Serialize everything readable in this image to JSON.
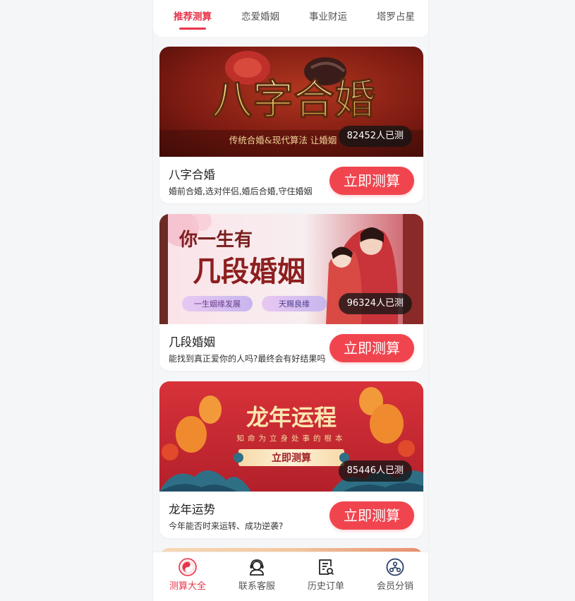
{
  "tabs": [
    {
      "label": "推荐测算",
      "active": true
    },
    {
      "label": "恋爱婚姻",
      "active": false
    },
    {
      "label": "事业财运",
      "active": false
    },
    {
      "label": "塔罗占星",
      "active": false
    }
  ],
  "cards": [
    {
      "banner_title": "八字合婚",
      "banner_subtitle": "传统合婚&现代算法  让婚姻",
      "count": "82452人已测",
      "title": "八字合婚",
      "desc": "婚前合婚,选对伴侣,婚后合婚,守住婚姻",
      "cta": "立即测算"
    },
    {
      "banner_title_top": "你一生有",
      "banner_title": "几段婚姻",
      "banner_tag1": "一生姻缘发展",
      "banner_tag2": "天赐良缘",
      "count": "96324人已测",
      "title": "几段婚姻",
      "desc": "能找到真正爱你的人吗?最终会有好结果吗",
      "cta": "立即测算"
    },
    {
      "banner_title": "龙年运程",
      "banner_subtitle": "知命为立身处事的根本",
      "banner_button": "立即测算",
      "count": "85446人已测",
      "title": "龙年运势",
      "desc": "今年能否时来运转、成功逆袭?",
      "cta": "立即测算"
    }
  ],
  "bottom_nav": [
    {
      "label": "测算大全",
      "icon": "yin-yang-icon",
      "active": true
    },
    {
      "label": "联系客服",
      "icon": "customer-service-icon",
      "active": false
    },
    {
      "label": "历史订单",
      "icon": "order-history-icon",
      "active": false
    },
    {
      "label": "会员分销",
      "icon": "member-share-icon",
      "active": false
    }
  ],
  "colors": {
    "accent": "#e8344a",
    "cta": "#f0454f",
    "background": "#f5f6f7"
  }
}
